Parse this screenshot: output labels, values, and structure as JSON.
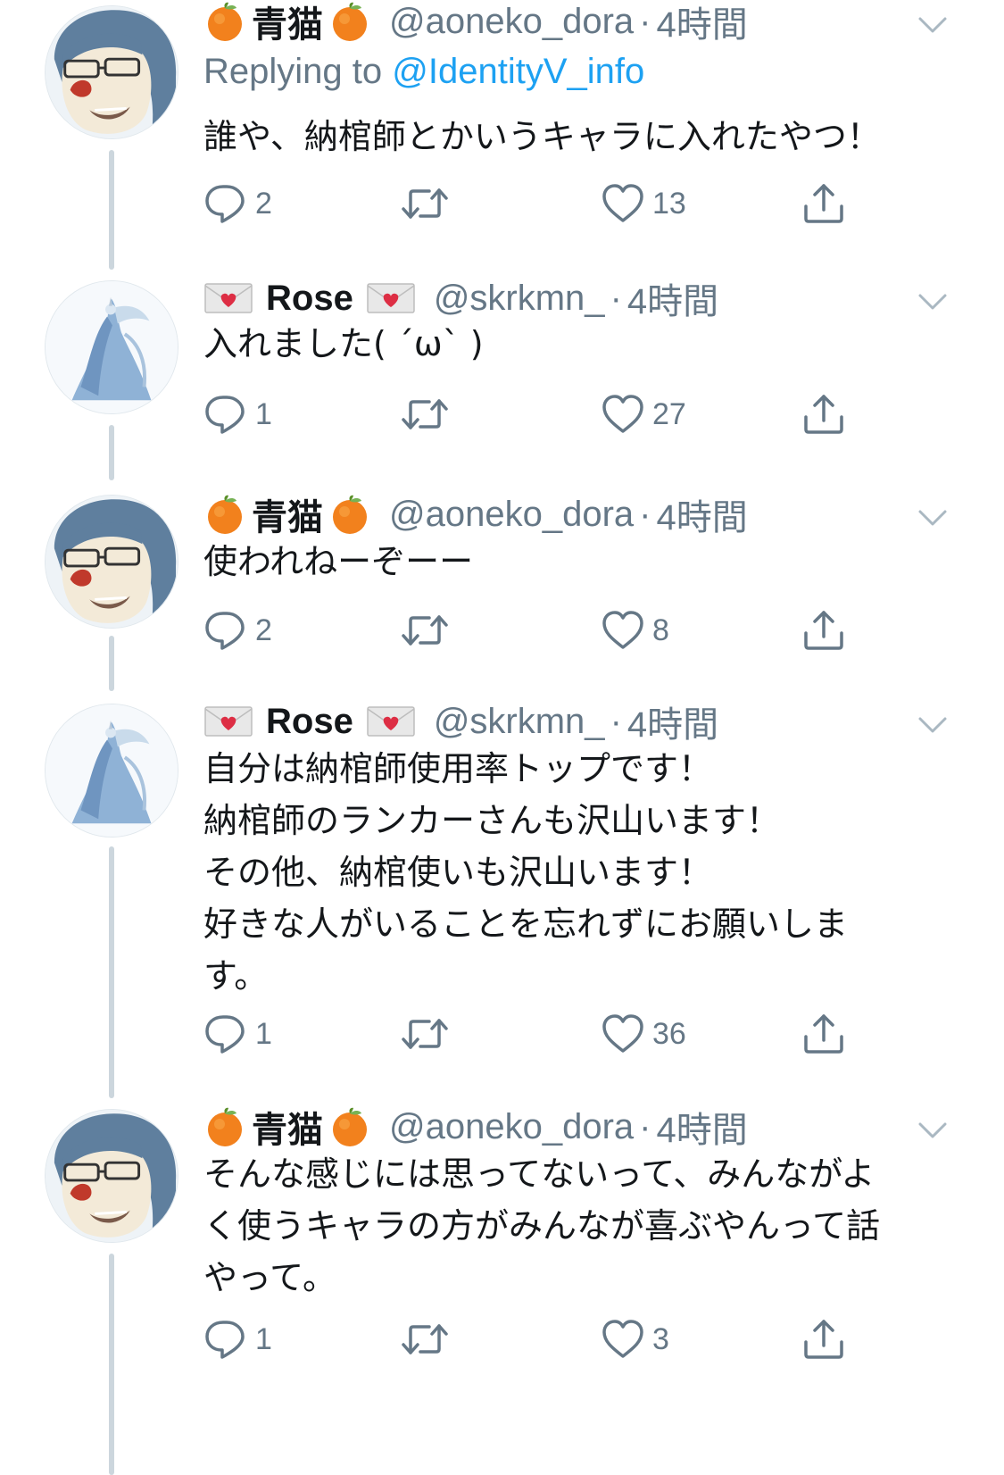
{
  "users": {
    "aoneko": {
      "display_name": "青猫",
      "handle": "@aoneko_dora",
      "emoji": "orange-icon"
    },
    "rose": {
      "display_name": "Rose",
      "handle": "@skrkmn_",
      "emoji": "love-letter-icon"
    }
  },
  "separator": "·",
  "colors": {
    "text": "#14171a",
    "secondary": "#657786",
    "link": "#1da1f2",
    "thread_line": "#ccd6dd"
  },
  "tweets": [
    {
      "author": "青猫",
      "handle": "@aoneko_dora",
      "time": "4時間",
      "replying_prefix": "Replying to",
      "replying_to": "@IdentityV_info",
      "text": "誰や、納棺師とかいうキャラに入れたやつ！",
      "replies": "2",
      "likes": "13"
    },
    {
      "author": "Rose",
      "handle": "@skrkmn_",
      "time": "4時間",
      "text": "入れました( ˊωˋ )",
      "replies": "1",
      "likes": "27"
    },
    {
      "author": "青猫",
      "handle": "@aoneko_dora",
      "time": "4時間",
      "text": "使われねーぞーー",
      "replies": "2",
      "likes": "8"
    },
    {
      "author": "Rose",
      "handle": "@skrkmn_",
      "time": "4時間",
      "text": "自分は納棺師使用率トップです！\n納棺師のランカーさんも沢山います！\nその他、納棺使いも沢山います！\n好きな人がいることを忘れずにお願いしま\nす。",
      "replies": "1",
      "likes": "36"
    },
    {
      "author": "青猫",
      "handle": "@aoneko_dora",
      "time": "4時間",
      "text": "そんな感じには思ってないって、みんながよ\nく使うキャラの方がみんなが喜ぶやんって話\nやって。",
      "replies": "1",
      "likes": "3"
    }
  ]
}
